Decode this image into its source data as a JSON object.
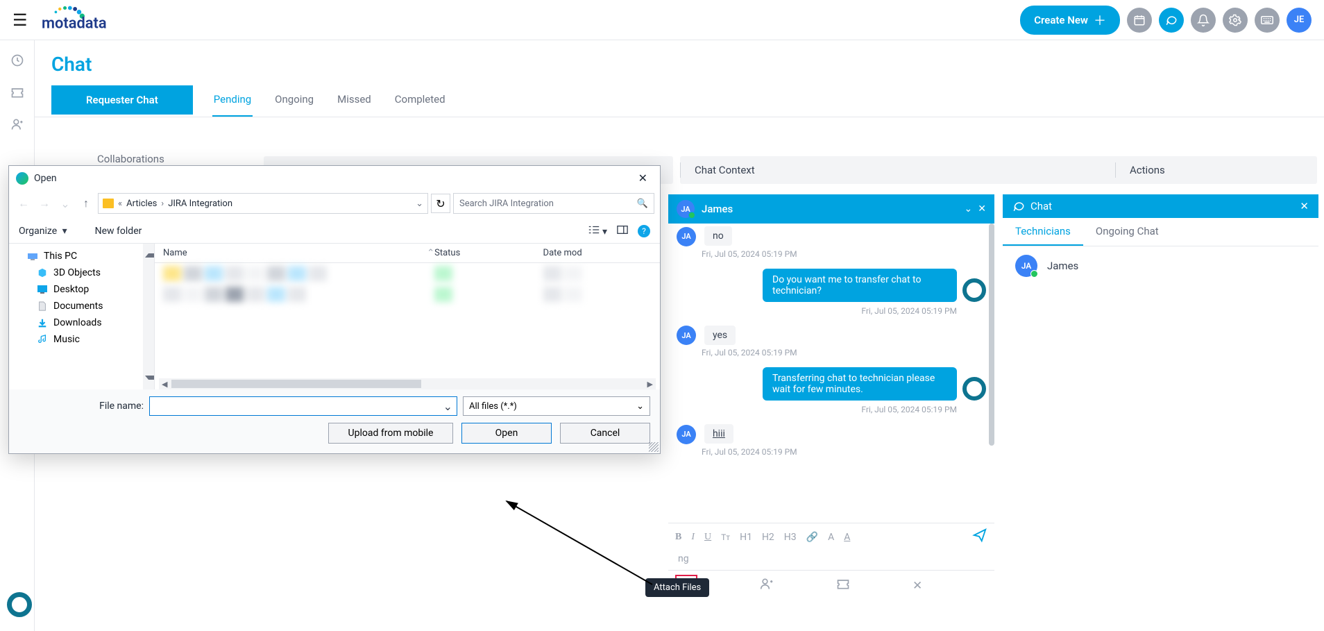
{
  "header": {
    "create_new": "Create New",
    "avatar_initials": "JE"
  },
  "page": {
    "title": "Chat",
    "requester_chat_btn": "Requester Chat",
    "collaborations": "Collaborations",
    "status_tabs": [
      "Pending",
      "Ongoing",
      "Missed",
      "Completed"
    ],
    "active_status_tab": 0,
    "context_tabs": {
      "chat_context": "Chat Context",
      "actions": "Actions"
    }
  },
  "chat": {
    "header_name": "James",
    "header_initials": "JA",
    "messages": [
      {
        "from": "user",
        "initials": "JA",
        "text": "no",
        "time": "Fri, Jul 05, 2024 05:19 PM"
      },
      {
        "from": "bot",
        "text": "Do you want me to transfer chat to technician?",
        "time": "Fri, Jul 05, 2024 05:19 PM"
      },
      {
        "from": "user",
        "initials": "JA",
        "text": "yes",
        "time": "Fri, Jul 05, 2024 05:19 PM"
      },
      {
        "from": "bot",
        "text": "Transferring chat to technician please wait for few minutes.",
        "time": "Fri, Jul 05, 2024 05:19 PM"
      },
      {
        "from": "user",
        "initials": "JA",
        "text": "hiii",
        "link": true,
        "time": "Fri, Jul 05, 2024 05:19 PM"
      }
    ],
    "toolbar": {
      "b": "B",
      "i": "I",
      "u": "U",
      "tt": "Tт",
      "h1": "H1",
      "h2": "H2",
      "h3": "H3"
    },
    "input_placeholder": "ng",
    "tooltip_attach": "Attach Files"
  },
  "side": {
    "header": "Chat",
    "tabs": [
      "Technicians",
      "Ongoing Chat"
    ],
    "active_tab": 0,
    "technician": {
      "initials": "JA",
      "name": "James"
    }
  },
  "dialog": {
    "title": "Open",
    "breadcrumb": {
      "left": "Articles",
      "right": "JIRA Integration",
      "ellipsis": "«"
    },
    "search_placeholder": "Search JIRA Integration",
    "toolbar": {
      "organize": "Organize",
      "new_folder": "New folder"
    },
    "tree": [
      {
        "label": "This PC",
        "icon": "pc"
      },
      {
        "label": "3D Objects",
        "icon": "3d",
        "indent": true
      },
      {
        "label": "Desktop",
        "icon": "desktop",
        "indent": true
      },
      {
        "label": "Documents",
        "icon": "docs",
        "indent": true
      },
      {
        "label": "Downloads",
        "icon": "downloads",
        "indent": true
      },
      {
        "label": "Music",
        "icon": "music",
        "indent": true
      }
    ],
    "columns": {
      "name": "Name",
      "status": "Status",
      "date": "Date mod"
    },
    "filename_label": "File name:",
    "filter": "All files (*.*)",
    "buttons": {
      "upload": "Upload from mobile",
      "open": "Open",
      "cancel": "Cancel"
    }
  }
}
